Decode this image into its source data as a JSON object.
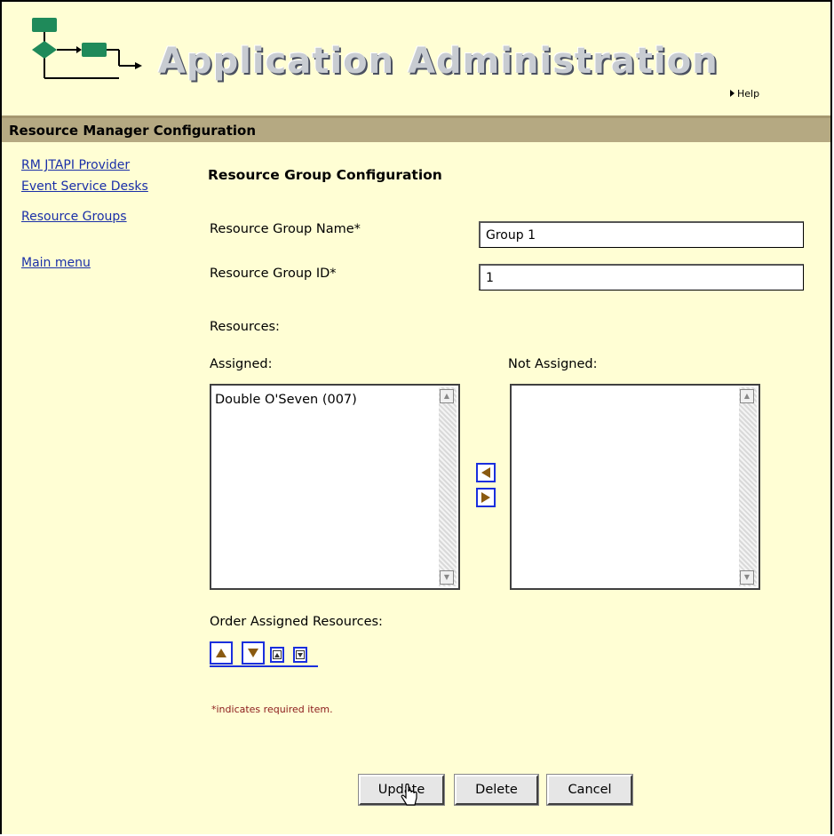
{
  "header": {
    "app_title": "Application Administration",
    "help_label": "Help"
  },
  "section": {
    "title": "Resource Manager Configuration"
  },
  "nav": {
    "items": [
      {
        "label": "RM JTAPI Provider"
      },
      {
        "label": "Event Service Desks"
      },
      {
        "label": "Resource Groups"
      }
    ],
    "main_menu": "Main menu"
  },
  "form": {
    "title": "Resource Group Configuration",
    "group_name_label": "Resource Group Name*",
    "group_name_value": "Group 1",
    "group_id_label": "Resource Group ID*",
    "group_id_value": "1",
    "resources_label": "Resources:",
    "assigned_label": "Assigned:",
    "not_assigned_label": "Not Assigned:",
    "assigned_items": [
      "Double O'Seven (007)"
    ],
    "not_assigned_items": [],
    "order_label": "Order Assigned Resources:",
    "required_note": "*indicates required item."
  },
  "buttons": {
    "update": "Update",
    "delete": "Delete",
    "cancel": "Cancel"
  },
  "colors": {
    "page_bg": "#fffed4",
    "section_bar": "#b5a982",
    "link": "#1a2fa8",
    "arrow_border": "#1a2fdd",
    "arrow_fill": "#8a5a10",
    "required_note": "#8b1a1a",
    "logo_green": "#1f8a5a"
  },
  "icons": {
    "logo": "workflow-diagram-icon",
    "move_left": "arrow-left-icon",
    "move_right": "arrow-right-icon",
    "move_up": "arrow-up-icon",
    "move_down": "arrow-down-icon",
    "move_top": "move-top-icon",
    "move_bottom": "move-bottom-icon"
  }
}
